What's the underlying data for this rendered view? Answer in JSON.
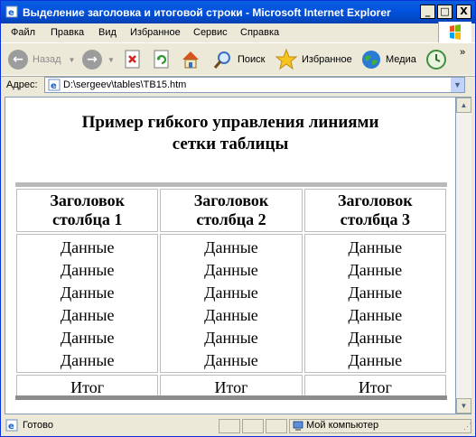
{
  "window": {
    "title": "Выделение заголовка и итоговой строки - Microsoft Internet Explorer",
    "minimize": "_",
    "maximize": "□",
    "close": "X"
  },
  "menu": [
    "Файл",
    "Правка",
    "Вид",
    "Избранное",
    "Сервис",
    "Справка"
  ],
  "toolbar": {
    "back": "Назад",
    "search": "Поиск",
    "favorites": "Избранное",
    "media": "Медиа"
  },
  "address": {
    "label": "Адрес:",
    "value": "D:\\sergeev\\tables\\TB15.htm"
  },
  "page": {
    "heading_line1": "Пример гибкого управления линиями",
    "heading_line2": "сетки таблицы",
    "headers": [
      {
        "line1": "Заголовок",
        "line2": "столбца 1"
      },
      {
        "line1": "Заголовок",
        "line2": "столбца 2"
      },
      {
        "line1": "Заголовок",
        "line2": "столбца 3"
      }
    ],
    "rows": [
      [
        "Данные",
        "Данные",
        "Данные"
      ],
      [
        "Данные",
        "Данные",
        "Данные"
      ],
      [
        "Данные",
        "Данные",
        "Данные"
      ],
      [
        "Данные",
        "Данные",
        "Данные"
      ],
      [
        "Данные",
        "Данные",
        "Данные"
      ],
      [
        "Данные",
        "Данные",
        "Данные"
      ]
    ],
    "footer": [
      "Итог",
      "Итог",
      "Итог"
    ]
  },
  "status": {
    "text": "Готово",
    "zone": "Мой компьютер"
  }
}
